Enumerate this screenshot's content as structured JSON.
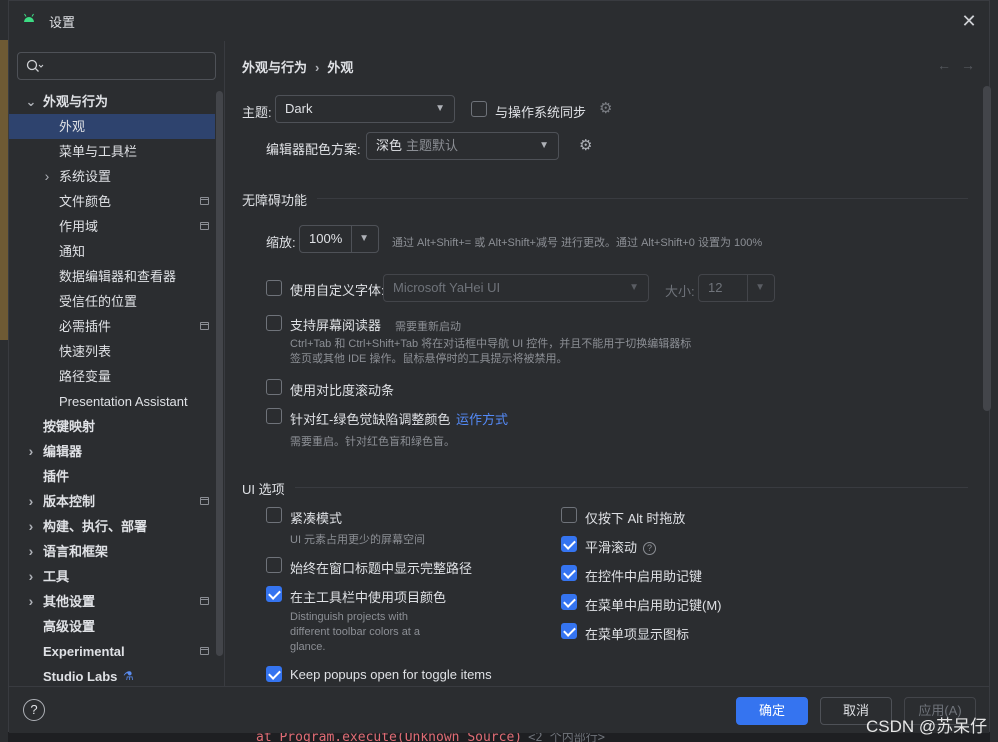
{
  "window": {
    "title": "设置",
    "close_icon": "close-icon"
  },
  "search": {
    "placeholder": ""
  },
  "sidebar": {
    "items": [
      {
        "label": "外观与行为",
        "level": 0,
        "expanded": true,
        "bold": true
      },
      {
        "label": "外观",
        "level": 1,
        "selected": true
      },
      {
        "label": "菜单与工具栏",
        "level": 1
      },
      {
        "label": "系统设置",
        "level": 1,
        "collapsed": true
      },
      {
        "label": "文件颜色",
        "level": 1,
        "badge": true
      },
      {
        "label": "作用域",
        "level": 1,
        "badge": true
      },
      {
        "label": "通知",
        "level": 1
      },
      {
        "label": "数据编辑器和查看器",
        "level": 1
      },
      {
        "label": "受信任的位置",
        "level": 1
      },
      {
        "label": "必需插件",
        "level": 1,
        "badge": true
      },
      {
        "label": "快速列表",
        "level": 1
      },
      {
        "label": "路径变量",
        "level": 1
      },
      {
        "label": "Presentation Assistant",
        "level": 1
      },
      {
        "label": "按键映射",
        "level": 0,
        "bold": true
      },
      {
        "label": "编辑器",
        "level": 0,
        "collapsed": true,
        "bold": true
      },
      {
        "label": "插件",
        "level": 0,
        "bold": true
      },
      {
        "label": "版本控制",
        "level": 0,
        "collapsed": true,
        "badge": true,
        "bold": true
      },
      {
        "label": "构建、执行、部署",
        "level": 0,
        "collapsed": true,
        "bold": true
      },
      {
        "label": "语言和框架",
        "level": 0,
        "collapsed": true,
        "bold": true
      },
      {
        "label": "工具",
        "level": 0,
        "collapsed": true,
        "bold": true
      },
      {
        "label": "其他设置",
        "level": 0,
        "collapsed": true,
        "badge": true,
        "bold": true
      },
      {
        "label": "高级设置",
        "level": 0,
        "bold": true
      },
      {
        "label": "Experimental",
        "level": 0,
        "badge": true,
        "bold": true
      },
      {
        "label": "Studio Labs",
        "level": 0,
        "bold": true,
        "flask": true
      }
    ]
  },
  "breadcrumb": {
    "parent": "外观与行为",
    "separator": "›",
    "current": "外观"
  },
  "nav": {
    "back": "←",
    "forward": "→"
  },
  "theme": {
    "label": "主题:",
    "value": "Dark",
    "sync_label": "与操作系统同步",
    "sync_checked": false
  },
  "scheme": {
    "label": "编辑器配色方案:",
    "value": "深色",
    "value_hint": "主题默认"
  },
  "accessibility": {
    "title": "无障碍功能",
    "zoom_label": "缩放:",
    "zoom_value": "100%",
    "zoom_hint": "通过 Alt+Shift+= 或 Alt+Shift+减号 进行更改。通过 Alt+Shift+0 设置为 100%",
    "custom_font_label": "使用自定义字体:",
    "custom_font_checked": false,
    "font_value": "Microsoft YaHei UI",
    "size_label": "大小:",
    "size_value": "12",
    "screen_reader_label": "支持屏幕阅读器",
    "screen_reader_note": "需要重新启动",
    "screen_reader_checked": false,
    "screen_reader_hint_1": "Ctrl+Tab 和 Ctrl+Shift+Tab 将在对话框中导航 UI 控件，并且不能用于切换编辑器标",
    "screen_reader_hint_2": "签页或其他 IDE 操作。鼠标悬停时的工具提示将被禁用。",
    "contrast_scrollbar_label": "使用对比度滚动条",
    "contrast_scrollbar_checked": false,
    "color_deficiency_label": "针对红-绿色觉缺陷调整颜色",
    "color_deficiency_link": "运作方式",
    "color_deficiency_checked": false,
    "color_deficiency_hint": "需要重启。针对红色盲和绿色盲。"
  },
  "ui_options": {
    "title": "UI 选项",
    "compact_label": "紧凑模式",
    "compact_checked": false,
    "compact_hint": "UI 元素占用更少的屏幕空间",
    "full_path_label": "始终在窗口标题中显示完整路径",
    "full_path_checked": false,
    "project_colors_label": "在主工具栏中使用项目颜色",
    "project_colors_checked": true,
    "project_colors_hint_1": "Distinguish projects with",
    "project_colors_hint_2": "different toolbar colors at a",
    "project_colors_hint_3": "glance.",
    "popups_label": "Keep popups open for toggle items",
    "popups_checked": true,
    "alt_drag_label": "仅按下 Alt 时拖放",
    "alt_drag_checked": false,
    "smooth_scroll_label": "平滑滚动",
    "smooth_scroll_checked": true,
    "smooth_scroll_help": "?",
    "mnemonics_controls_label": "在控件中启用助记键",
    "mnemonics_controls_checked": true,
    "mnemonics_menu_label": "在菜单中启用助记键(M)",
    "mnemonics_menu_checked": true,
    "menu_icons_label": "在菜单项显示图标",
    "menu_icons_checked": true
  },
  "footer": {
    "help": "?",
    "ok": "确定",
    "cancel": "取消",
    "apply": "应用(A)"
  },
  "background": {
    "code_line": "at Program.execute(Unknown Source)",
    "code_hint": "<2 个内部行>"
  },
  "watermark": "CSDN @苏呆仔",
  "colors": {
    "accent": "#3574f0",
    "selection": "#2e436e",
    "link": "#548af7",
    "background": "#2b2d30"
  }
}
